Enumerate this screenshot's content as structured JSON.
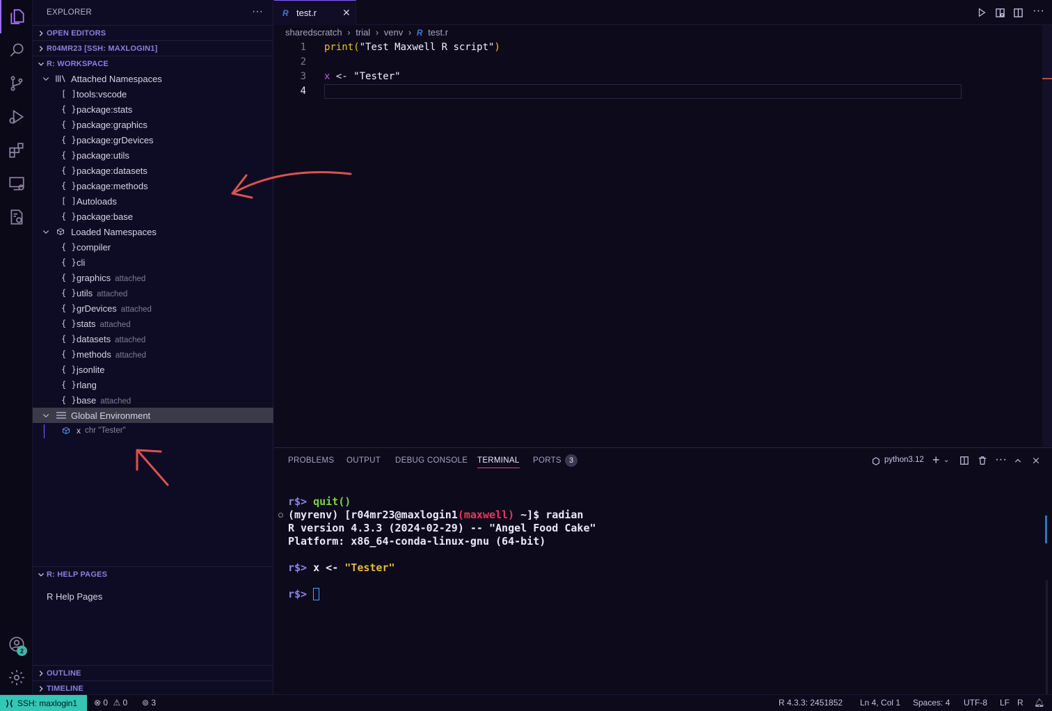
{
  "sidebar": {
    "title": "EXPLORER",
    "sections": {
      "open_editors": "OPEN EDITORS",
      "remote": "R04MR23 [SSH: MAXLOGIN1]",
      "workspace": "R: WORKSPACE",
      "help": "R: HELP PAGES",
      "outline": "OUTLINE",
      "timeline": "TIMELINE"
    },
    "attached_header": "Attached Namespaces",
    "attached": [
      {
        "icon": "[ ]",
        "label": "tools:vscode"
      },
      {
        "icon": "{ }",
        "label": "package:stats"
      },
      {
        "icon": "{ }",
        "label": "package:graphics"
      },
      {
        "icon": "{ }",
        "label": "package:grDevices"
      },
      {
        "icon": "{ }",
        "label": "package:utils"
      },
      {
        "icon": "{ }",
        "label": "package:datasets"
      },
      {
        "icon": "{ }",
        "label": "package:methods"
      },
      {
        "icon": "[ ]",
        "label": "Autoloads"
      },
      {
        "icon": "{ }",
        "label": "package:base"
      }
    ],
    "loaded_header": "Loaded Namespaces",
    "loaded": [
      {
        "label": "compiler",
        "note": ""
      },
      {
        "label": "cli",
        "note": ""
      },
      {
        "label": "graphics",
        "note": "attached"
      },
      {
        "label": "utils",
        "note": "attached"
      },
      {
        "label": "grDevices",
        "note": "attached"
      },
      {
        "label": "stats",
        "note": "attached"
      },
      {
        "label": "datasets",
        "note": "attached"
      },
      {
        "label": "methods",
        "note": "attached"
      },
      {
        "label": "jsonlite",
        "note": ""
      },
      {
        "label": "rlang",
        "note": ""
      },
      {
        "label": "base",
        "note": "attached"
      }
    ],
    "global_header": "Global Environment",
    "global_var": "x",
    "global_value": "chr \"Tester\"",
    "help_item": "R Help Pages",
    "account_badge": "2"
  },
  "editor": {
    "tab_label": "test.r",
    "breadcrumb": [
      "sharedscratch",
      "trial",
      "venv",
      "test.r"
    ],
    "lines": [
      "1",
      "2",
      "3",
      "4"
    ],
    "line1_fn": "print",
    "line1_open": "(",
    "line1_str": "\"Test Maxwell R script\"",
    "line1_close": ")",
    "line3_var": "x",
    "line3_op": " <- ",
    "line3_str": "\"Tester\""
  },
  "panel": {
    "tabs": [
      "PROBLEMS",
      "OUTPUT",
      "DEBUG CONSOLE",
      "TERMINAL",
      "PORTS"
    ],
    "ports_count": "3",
    "shell": "python3.12",
    "term": {
      "p1": "r$> ",
      "quit": "quit()",
      "l2a": "(myrenv) [r04mr23@maxlogin1",
      "l2b": "(maxwell)",
      "l2c": " ~]$ radian",
      "l3": "R version 4.3.3 (2024-02-29) -- \"Angel Food Cake\"",
      "l4": "Platform: x86_64-conda-linux-gnu (64-bit)",
      "p2": "r$> ",
      "assign": "x <- ",
      "assign_str": "\"Tester\"",
      "p3": "r$> "
    }
  },
  "status": {
    "ssh": "SSH: maxlogin1",
    "errors": "0",
    "warnings": "0",
    "ports": "3",
    "r_version": "R 4.3.3: 2451852",
    "position": "Ln 4, Col 1",
    "spaces": "Spaces: 4",
    "encoding": "UTF-8",
    "eol": "LF",
    "language": "R"
  },
  "colors": {
    "accent": "#9b6cff",
    "ssh_bg": "#33c7b5",
    "annotation_arrow": "#d9534f"
  }
}
